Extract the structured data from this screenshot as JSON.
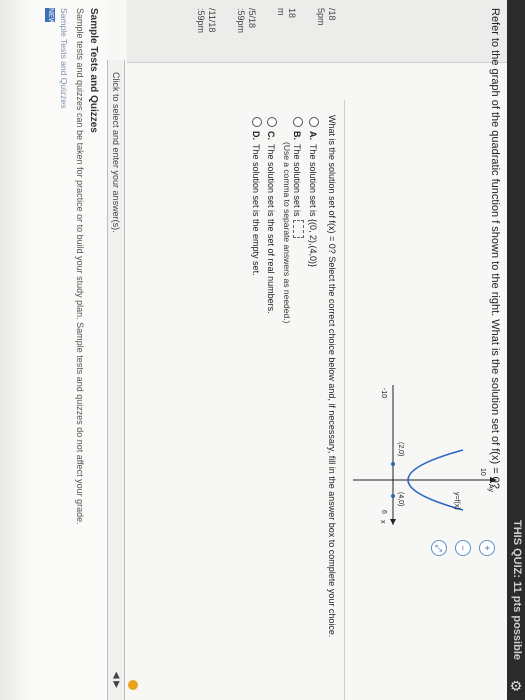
{
  "header": {
    "title": "THIS QUIZ: 11 pts possible"
  },
  "prompt": "Refer to the graph of the quadratic function f shown to the right. What is the solution set of f(x) = 0?",
  "question": "What is the solution set of f(x) = 0? Select the correct choice below and, if necessary, fill in the answer box to complete your choice.",
  "choices": [
    {
      "letter": "A.",
      "text": "The solution set is {(0, 2),(4,0)}"
    },
    {
      "letter": "B.",
      "text": "The solution set is"
    },
    {
      "letter": "C.",
      "text": "The solution set is the set of real numbers."
    },
    {
      "letter": "D.",
      "text": "The solution set is the empty set."
    }
  ],
  "choice_b_note": "(Use a comma to separate answers as needed.)",
  "graph": {
    "y_label": "Ay",
    "x_label": "x",
    "y_top_tick": "10",
    "x_left_tick": "-10",
    "x_right_tick": "6",
    "func_label": "y=f(x)",
    "point_a": "(2,0)",
    "point_b": "(4,0)"
  },
  "due_dates": [
    "/18",
    "5pm",
    "",
    "18",
    "m",
    "",
    "/5/18",
    ":59pm",
    "",
    "/11/18",
    ":59pm"
  ],
  "bottom": {
    "click_msg": "Click to select and enter your answer(s)."
  },
  "footer": {
    "title": "Sample Tests and Quizzes",
    "desc": "Sample tests and quizzes can be taken for practice or to build your study plan. Sample tests and quizzes do not affect your grade.",
    "link": "Sample Tests and Quizzes",
    "badge": "NEW"
  }
}
